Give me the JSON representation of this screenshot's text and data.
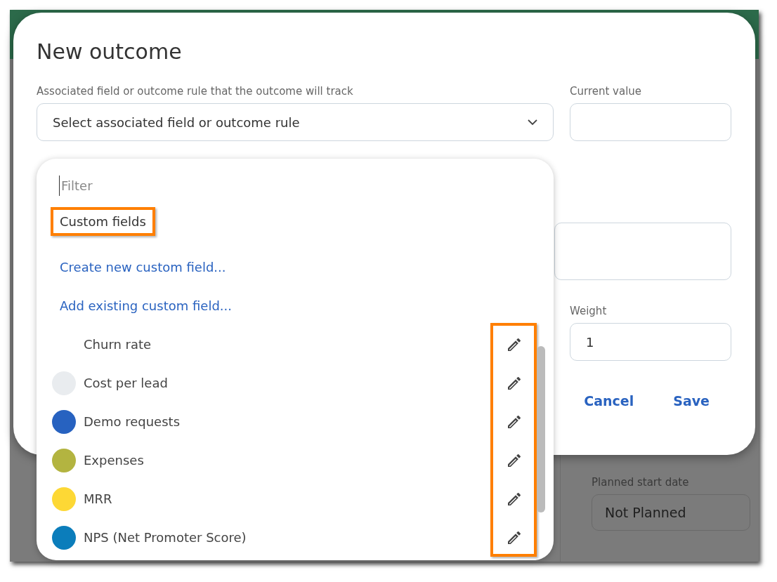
{
  "background": {
    "planned_start": {
      "label": "Planned start date",
      "value": "Not Planned"
    }
  },
  "dialog": {
    "title": "New outcome",
    "associated_field": {
      "label": "Associated field or outcome rule that the outcome will track",
      "placeholder": "Select associated field or outcome rule"
    },
    "current_value": {
      "label": "Current value"
    },
    "weight": {
      "label": "Weight",
      "value": "1"
    },
    "buttons": [
      "Cancel",
      "Save"
    ]
  },
  "dropdown": {
    "filter": {
      "placeholder": "Filter"
    },
    "section": {
      "title": "Custom fields",
      "highlighted": true
    },
    "links": [
      "Create new custom field...",
      "Add existing custom field..."
    ],
    "edit_column_highlighted": true,
    "items": [
      {
        "label": "Churn rate"
      },
      {
        "label": "Cost per lead",
        "color": "#e9ecef"
      },
      {
        "label": "Demo requests",
        "color": "#2762c0"
      },
      {
        "label": "Expenses",
        "color": "#b3b440"
      },
      {
        "label": "MRR",
        "color": "#fdd835"
      },
      {
        "label": "NPS (Net Promoter Score)",
        "color": "#0b7dbb"
      }
    ]
  }
}
